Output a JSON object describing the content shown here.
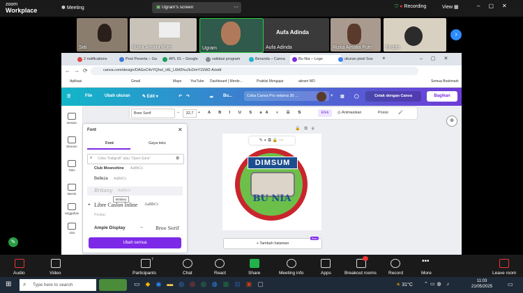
{
  "zoom": {
    "logo_line1": "zoom",
    "logo_line2": "Workplace",
    "meeting_label": "Meeting",
    "share_banner": "Ugram's screen",
    "recording": "Recording",
    "view": "View",
    "participants": [
      {
        "name": "Sitti"
      },
      {
        "name": "Rizka Amalia Putri"
      },
      {
        "name": "Ugram"
      },
      {
        "name": "Aufa Adinda"
      },
      {
        "name": "Rizka Amalia Putri"
      },
      {
        "name": "Endah"
      }
    ],
    "featured_name": "Aufa Adinda",
    "controls": [
      {
        "label": "Audio"
      },
      {
        "label": "Video"
      },
      {
        "label": "Participants",
        "count": "7"
      },
      {
        "label": "Chat"
      },
      {
        "label": "React"
      },
      {
        "label": "Share"
      },
      {
        "label": "Meeting info"
      },
      {
        "label": "Apps"
      },
      {
        "label": "Breakout rooms"
      },
      {
        "label": "Record"
      },
      {
        "label": "More"
      }
    ],
    "leave": "Leave room"
  },
  "browser": {
    "tabs": [
      "2 notifications",
      "Post Peserta – Ga",
      "APL 01 – Google",
      "validasi program",
      "Beranda – Canva",
      "Bu Nia – Logo",
      "ukuran pixel Sos"
    ],
    "url": "canva.com/design/DAGoC4vYQho/_HE_L6M2huJIcDmY15W2-A/edit",
    "bookmarks": [
      "Aplikasi",
      "Gmail",
      "Maps",
      "YouTube",
      "Dashboard | Merde...",
      "Praktisi Mengajar",
      "abram WD",
      "Semua Bookmark"
    ]
  },
  "canva": {
    "menu": [
      "File",
      "Ubah ukuran",
      "Edit"
    ],
    "doc_title": "Bu...",
    "pro_banner": "Coba Canva Pro selama 30 ...",
    "print": "Cetak dengan Canva",
    "share": "Bagikan",
    "font_name": "Bree Serif",
    "font_size": "32,7",
    "effect": "Efek",
    "animate": "Animasikan",
    "position": "Posisi",
    "sidebar": [
      "Desain",
      "Elemen",
      "Teks",
      "Merek",
      "Unggahan",
      "Alat"
    ],
    "panel": {
      "title": "Font",
      "tab_font": "Font",
      "tab_style": "Gaya teks",
      "search_placeholder": "Coba \"Kaligrafi\" atau \"Open Sans\"",
      "fonts": [
        "Club Moonshine",
        "Belleza",
        "Britany",
        "Libre Caslon Inline",
        "Pontiac"
      ],
      "samples": [
        "AaBbCc",
        "AaBbCc",
        "AaBbCc",
        "AaBbCc",
        "AaBbCc"
      ],
      "tooltip": "Brittany",
      "pair_from": "Ample Display",
      "pair_to": "Bree Serif",
      "apply_all": "Ubah semua"
    },
    "logo_top": "DIMSUM",
    "logo_bottom": "BU NIA",
    "add_page": "+ Tambah halaman",
    "new_badge": "Baru"
  },
  "taskbar": {
    "search": "Type here to search",
    "temp": "31°C",
    "time": "11:03",
    "date": "21/05/2025"
  }
}
